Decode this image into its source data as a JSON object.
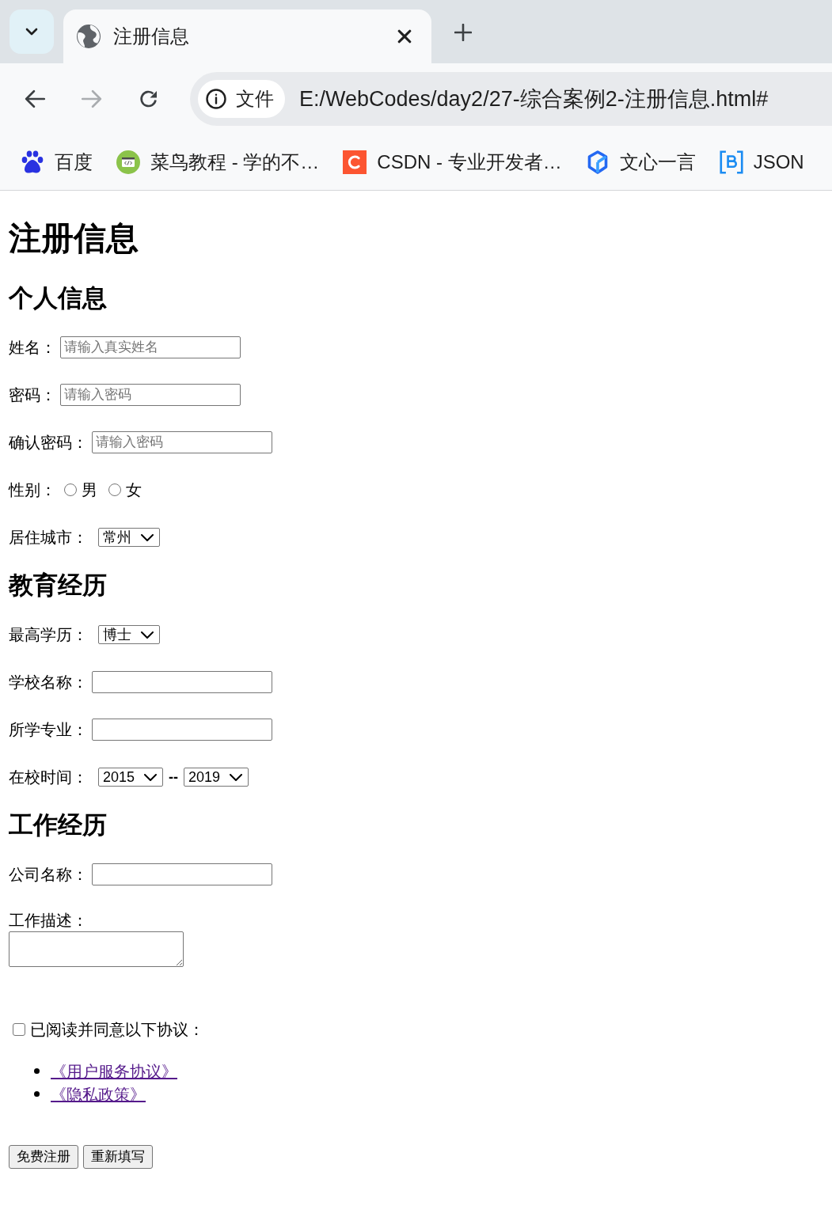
{
  "browser": {
    "tabs": [
      {
        "title": "注册信息",
        "selected": true
      }
    ],
    "nav_buttons": [
      {
        "kind": "back",
        "disabled": false
      },
      {
        "kind": "forward",
        "disabled": true
      },
      {
        "kind": "reload",
        "disabled": false
      }
    ],
    "address_bar": {
      "chip": "文件",
      "url": "E:/WebCodes/day2/27-综合案例2-注册信息.html#"
    },
    "bookmarks": [
      {
        "label": "百度"
      },
      {
        "label": "菜鸟教程 - 学的不…"
      },
      {
        "label": "CSDN - 专业开发者…"
      },
      {
        "label": "文心一言"
      },
      {
        "label": "JSON"
      }
    ]
  },
  "page": {
    "title": "注册信息",
    "sections": [
      {
        "heading": "个人信息",
        "fields": [
          {
            "kind": "text",
            "label": "姓名：",
            "placeholder": "请输入真实姓名"
          },
          {
            "kind": "text",
            "label": "密码：",
            "placeholder": "请输入密码"
          },
          {
            "kind": "text",
            "label": "确认密码：",
            "placeholder": "请输入密码"
          },
          {
            "kind": "radio",
            "label": "性别：",
            "options": [
              {
                "label": "男",
                "selected": false
              },
              {
                "label": "女",
                "selected": false
              }
            ]
          },
          {
            "kind": "select",
            "label": "居住城市：",
            "value": "常州"
          }
        ]
      },
      {
        "heading": "教育经历",
        "fields": [
          {
            "kind": "select",
            "label": "最高学历：",
            "value": "博士"
          },
          {
            "kind": "text",
            "label": "学校名称："
          },
          {
            "kind": "text",
            "label": "所学专业："
          },
          {
            "kind": "range",
            "label": "在校时间：",
            "from": "2015",
            "separator": "--",
            "to": "2019"
          }
        ]
      },
      {
        "heading": "工作经历",
        "fields": [
          {
            "kind": "text",
            "label": "公司名称："
          },
          {
            "kind": "textarea",
            "label": "工作描述："
          }
        ]
      }
    ],
    "agreement": {
      "checked": false,
      "label": "已阅读并同意以下协议：",
      "links": [
        {
          "text": "《用户服务协议》",
          "visited": true
        },
        {
          "text": "《隐私政策》",
          "visited": true
        }
      ]
    },
    "buttons": [
      {
        "label": "免费注册"
      },
      {
        "label": "重新填写"
      }
    ]
  }
}
